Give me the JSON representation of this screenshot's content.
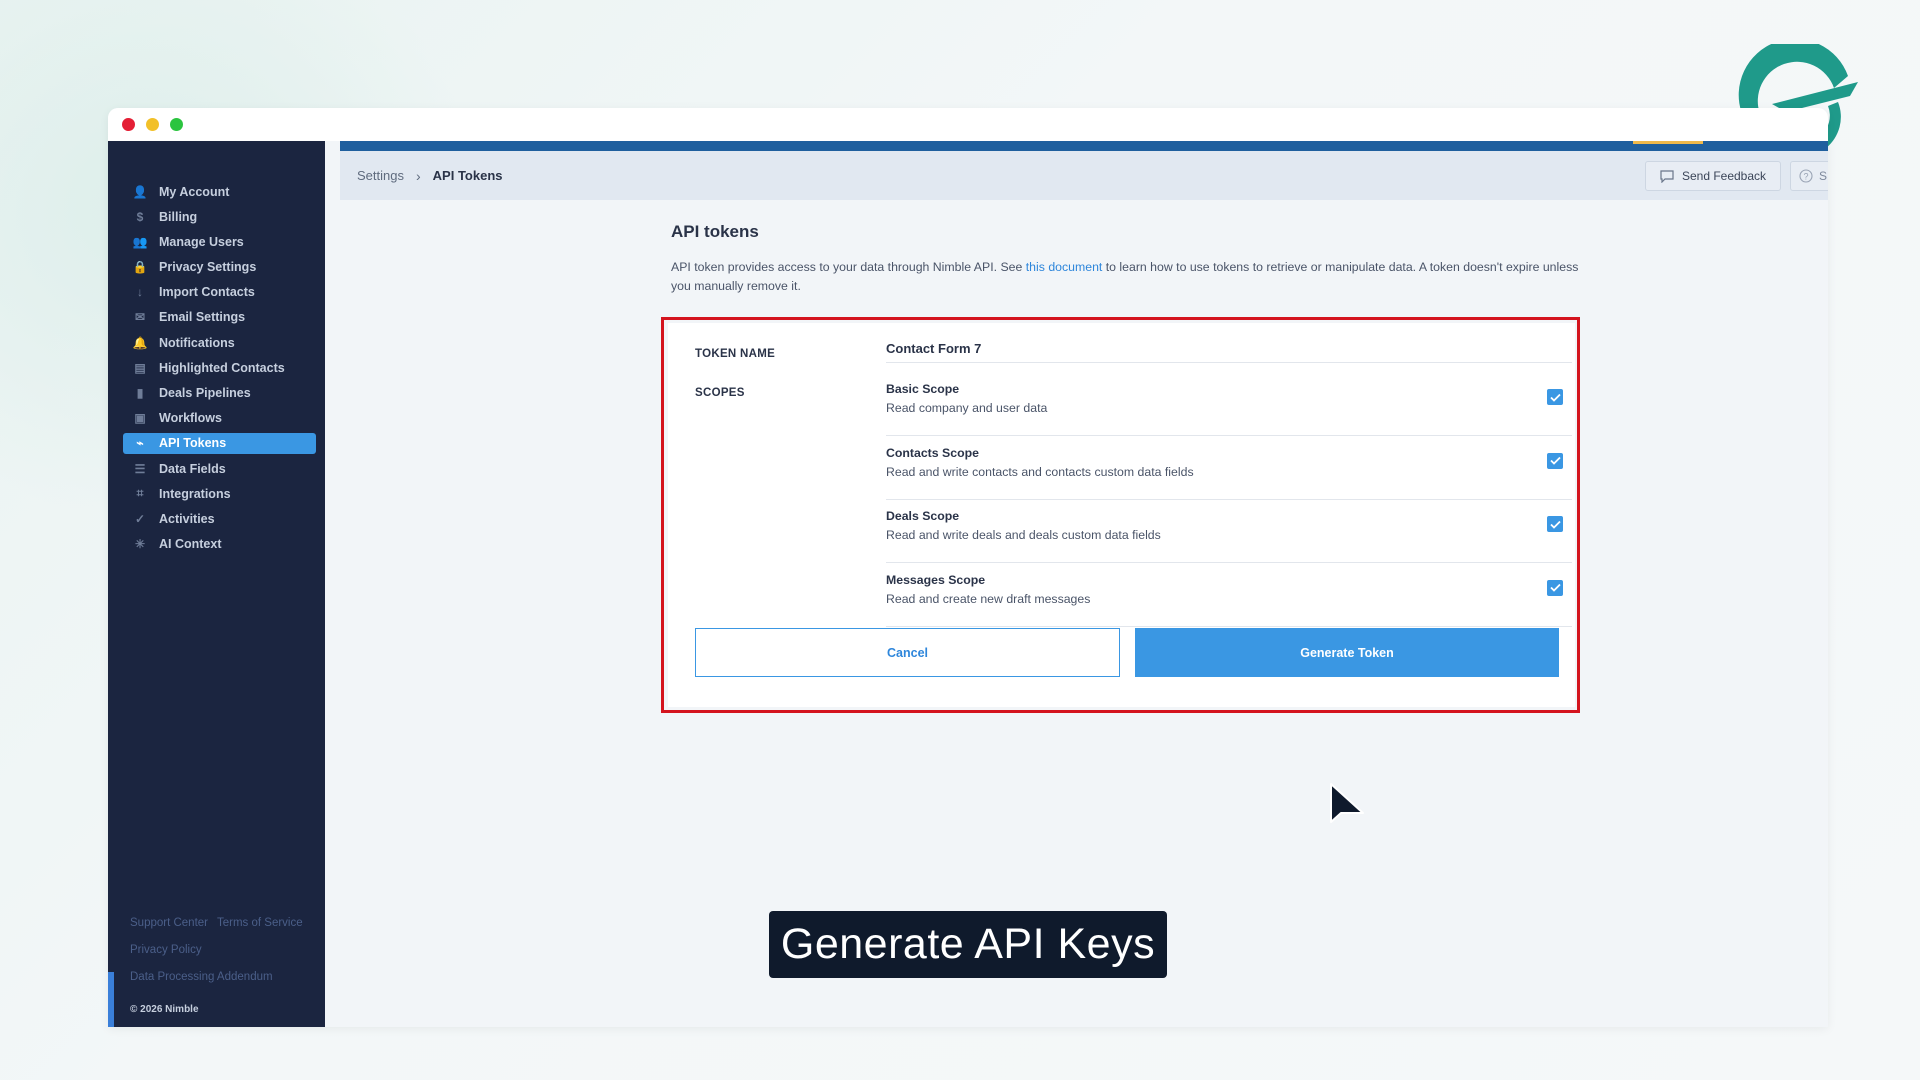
{
  "sidebar": {
    "items": [
      {
        "label": "My Account",
        "icon": "user-icon",
        "glyph": "👤"
      },
      {
        "label": "Billing",
        "icon": "dollar-icon",
        "glyph": "$"
      },
      {
        "label": "Manage Users",
        "icon": "users-icon",
        "glyph": "👥"
      },
      {
        "label": "Privacy Settings",
        "icon": "lock-icon",
        "glyph": "🔒"
      },
      {
        "label": "Import Contacts",
        "icon": "download-icon",
        "glyph": "↓"
      },
      {
        "label": "Email Settings",
        "icon": "envelope-icon",
        "glyph": "✉"
      },
      {
        "label": "Notifications",
        "icon": "bell-icon",
        "glyph": "🔔"
      },
      {
        "label": "Highlighted Contacts",
        "icon": "contact-card-icon",
        "glyph": "▤"
      },
      {
        "label": "Deals Pipelines",
        "icon": "bar-chart-icon",
        "glyph": "▮"
      },
      {
        "label": "Workflows",
        "icon": "workflow-icon",
        "glyph": "▣"
      },
      {
        "label": "API Tokens",
        "icon": "api-icon",
        "glyph": "⌁",
        "active": true
      },
      {
        "label": "Data Fields",
        "icon": "list-icon",
        "glyph": "☰"
      },
      {
        "label": "Integrations",
        "icon": "integrations-icon",
        "glyph": "⌗"
      },
      {
        "label": "Activities",
        "icon": "check-icon",
        "glyph": "✓"
      },
      {
        "label": "AI Context",
        "icon": "sparkle-icon",
        "glyph": "✳"
      }
    ],
    "footer": {
      "support": "Support Center",
      "terms": "Terms of Service",
      "privacy": "Privacy Policy",
      "dpa": "Data Processing Addendum",
      "copyright": "© 2026 Nimble"
    }
  },
  "breadcrumb": {
    "parent": "Settings",
    "separator": "›",
    "current": "API Tokens"
  },
  "toolbar": {
    "feedback_label": "Send Feedback",
    "help_label": "S"
  },
  "page": {
    "title": "API tokens",
    "description_before_link": "API token provides access to your data through Nimble API. See ",
    "link_text": "this document",
    "description_after_link": " to learn how to use tokens to retrieve or manipulate data. A token doesn't expire unless you manually remove it."
  },
  "form": {
    "token_name_label": "TOKEN NAME",
    "token_name_value": "Contact Form 7",
    "scopes_label": "SCOPES",
    "scopes": [
      {
        "title": "Basic Scope",
        "description": "Read company and user data",
        "checked": true
      },
      {
        "title": "Contacts Scope",
        "description": "Read and write contacts and contacts custom data fields",
        "checked": true
      },
      {
        "title": "Deals Scope",
        "description": "Read and write deals and deals custom data fields",
        "checked": true
      },
      {
        "title": "Messages Scope",
        "description": "Read and create new draft messages",
        "checked": true
      }
    ],
    "cancel_label": "Cancel",
    "generate_label": "Generate Token"
  },
  "caption": "Generate API Keys",
  "colors": {
    "sidebar_bg": "#1b2540",
    "accent": "#3a97e3",
    "highlight_border": "#d4141e",
    "brand_logo": "#1f9a8a"
  }
}
